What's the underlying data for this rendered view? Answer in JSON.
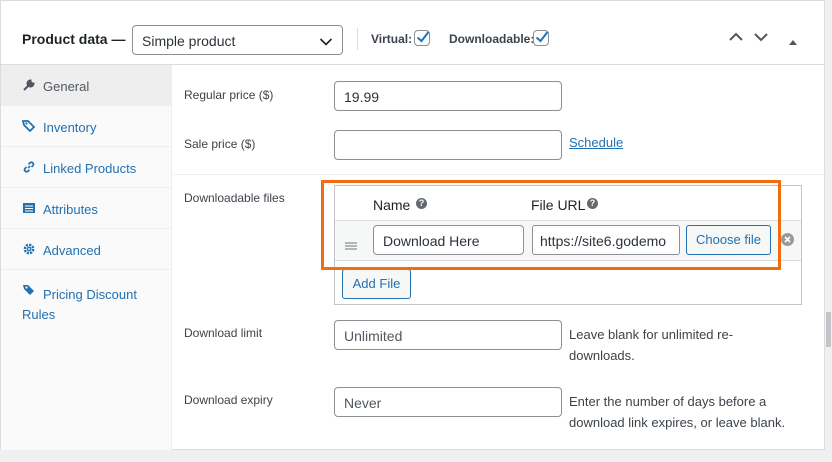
{
  "header": {
    "title": "Product data —",
    "product_type": "Simple product",
    "virtual_label": "Virtual:",
    "virtual_checked": true,
    "downloadable_label": "Downloadable:",
    "downloadable_checked": true,
    "move_up_icon": "chevron-up-icon",
    "move_down_icon": "chevron-down-icon",
    "toggle_icon": "triangle-up-icon"
  },
  "sidebar": {
    "items": [
      {
        "label": "General",
        "icon": "wrench-icon",
        "active": true
      },
      {
        "label": "Inventory",
        "icon": "tag-icon"
      },
      {
        "label": "Linked Products",
        "icon": "link-icon"
      },
      {
        "label": "Attributes",
        "icon": "table-icon"
      },
      {
        "label": "Advanced",
        "icon": "gear-icon"
      },
      {
        "label": "Pricing Discount Rules",
        "icon": "tag-icon"
      }
    ]
  },
  "general": {
    "regular_price_label": "Regular price ($)",
    "regular_price_value": "19.99",
    "sale_price_label": "Sale price ($)",
    "sale_price_value": "",
    "schedule_link": "Schedule",
    "downloadable_files_label": "Downloadable files",
    "files_table": {
      "col_name": "Name",
      "col_url": "File URL",
      "rows": [
        {
          "name": "Download Here",
          "url": "https://site6.godemo",
          "choose_label": "Choose file"
        }
      ],
      "add_file_label": "Add File"
    },
    "download_limit_label": "Download limit",
    "download_limit_placeholder": "Unlimited",
    "download_limit_desc": "Leave blank for unlimited re-downloads.",
    "download_expiry_label": "Download expiry",
    "download_expiry_placeholder": "Never",
    "download_expiry_desc": "Enter the number of days before a download link expires, or leave blank."
  },
  "colors": {
    "accent": "#2271b1",
    "highlight": "#f26d0f"
  }
}
